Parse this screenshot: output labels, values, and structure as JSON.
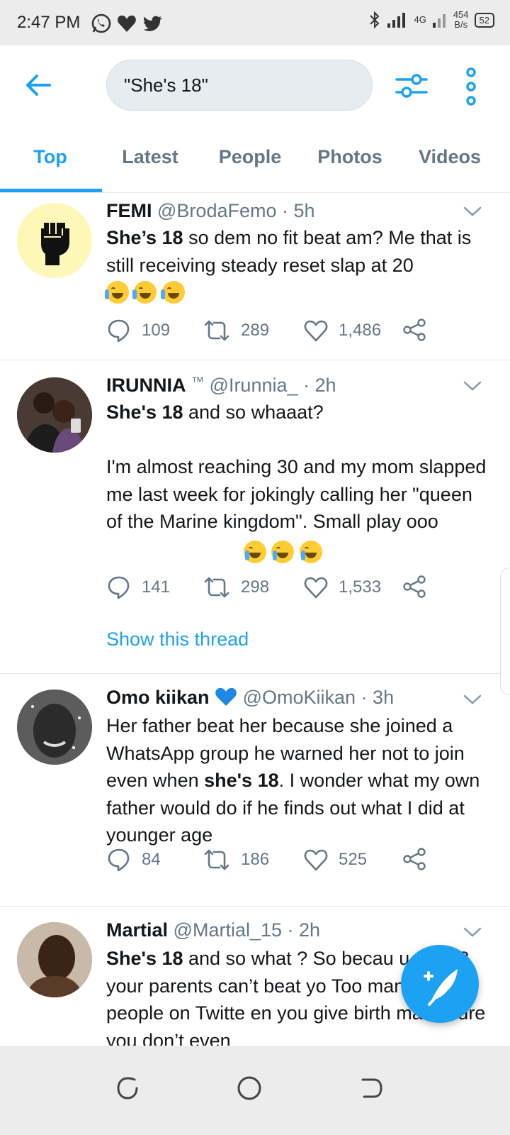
{
  "status_bar": {
    "time": "2:47 PM",
    "net_speed": "454",
    "net_unit": "B/s",
    "network_type": "4G",
    "battery": "52",
    "app_icons": [
      "whatsapp-icon",
      "heart-icon",
      "twitter-icon"
    ]
  },
  "header": {
    "search_value": "\"She's 18\""
  },
  "tabs": [
    {
      "label": "Top",
      "active": true
    },
    {
      "label": "Latest",
      "active": false
    },
    {
      "label": "People",
      "active": false
    },
    {
      "label": "Photos",
      "active": false
    },
    {
      "label": "Videos",
      "active": false
    }
  ],
  "tweets": [
    {
      "name": "FEMI",
      "handle": "@BrodaFemo",
      "time": "· 5h",
      "body_bold": "She’s 18",
      "body_rest": " so dem no fit beat am? Me that is still receiving steady reset slap at 20",
      "replies": "109",
      "retweets": "289",
      "likes": "1,486"
    },
    {
      "name": "IRUNNIA",
      "name_suffix": "™",
      "handle": "@Irunnia_",
      "time": "· 2h",
      "body_bold": "She's 18",
      "body_rest": " and so whaaat?\n\nI'm almost reaching 30 and my mom slapped me last week for jokingly calling her \"queen of the Marine kingdom\". Small play ooo",
      "replies": "141",
      "retweets": "298",
      "likes": "1,533",
      "thread_link": "Show this thread"
    },
    {
      "name": "Omo kiikan",
      "handle": "@OmoKiikan",
      "time": "· 3h",
      "body_pre": "Her father beat her because she joined a WhatsApp group he warned her not to join even when ",
      "body_bold": "she's 18",
      "body_rest": ". I wonder what my own father would do if he finds out what I did at younger age",
      "replies": "84",
      "retweets": "186",
      "likes": "525"
    },
    {
      "name": "Martial",
      "handle": "@Martial_15",
      "time": "· 2h",
      "body_bold": "She's 18",
      "body_rest": " and so what ? So  becau      u are 18 your parents can’t beat yo Too many woke people on Twitte      en you give birth make sure you don’t even"
    }
  ],
  "colors": {
    "accent": "#1da1f2",
    "muted": "#657786",
    "text": "#14171a"
  }
}
